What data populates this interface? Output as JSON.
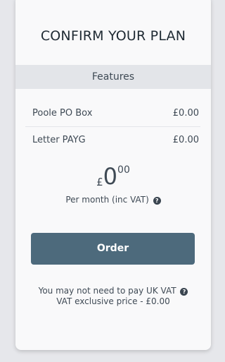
{
  "card": {
    "title": "CONFIRM YOUR PLAN",
    "features_header": "Features",
    "features": [
      {
        "name": "Poole PO Box",
        "price": "£0.00"
      },
      {
        "name": "Letter PAYG",
        "price": "£0.00"
      }
    ],
    "price": {
      "currency": "£",
      "amount": "0",
      "decimals": "00",
      "period": "Per month (inc VAT)"
    },
    "order_label": "Order",
    "vat_note": "You may not need to pay UK VAT",
    "vat_exclusive": "VAT exclusive price - £0.00"
  },
  "icons": {
    "help_glyph": "?"
  },
  "colors": {
    "button": "#4d6a7c",
    "features_bar": "#e3e5e9",
    "background": "#e6e7eb"
  }
}
